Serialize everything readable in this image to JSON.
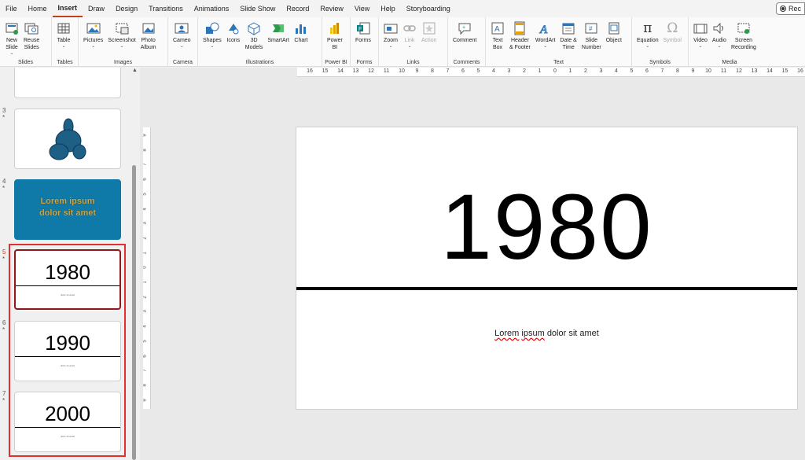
{
  "menu": {
    "tabs": [
      "File",
      "Home",
      "Insert",
      "Draw",
      "Design",
      "Transitions",
      "Animations",
      "Slide Show",
      "Record",
      "Review",
      "View",
      "Help",
      "Storyboarding"
    ],
    "active_tab": "Insert",
    "record_button": "Rec"
  },
  "ribbon": {
    "groups": {
      "slides": "Slides",
      "tables": "Tables",
      "images": "Images",
      "camera": "Camera",
      "illustrations": "Illustrations",
      "powerbi": "Power BI",
      "forms": "Forms",
      "links": "Links",
      "comments": "Comments",
      "text": "Text",
      "symbols": "Symbols",
      "media": "Media"
    },
    "buttons": {
      "new_slide": [
        "New",
        "Slide"
      ],
      "reuse_slides": [
        "Reuse",
        "Slides"
      ],
      "table": "Table",
      "pictures": "Pictures",
      "screenshot": "Screenshot",
      "photo_album": [
        "Photo",
        "Album"
      ],
      "cameo": "Cameo",
      "shapes": "Shapes",
      "icons": "Icons",
      "models_3d": [
        "3D",
        "Models"
      ],
      "smartart": "SmartArt",
      "chart": "Chart",
      "power_bi": [
        "Power",
        "BI"
      ],
      "forms": "Forms",
      "zoom": "Zoom",
      "link": "Link",
      "action": "Action",
      "comment": "Comment",
      "text_box": [
        "Text",
        "Box"
      ],
      "header_footer": [
        "Header",
        "& Footer"
      ],
      "wordart": "WordArt",
      "date_time": [
        "Date &",
        "Time"
      ],
      "slide_number": [
        "Slide",
        "Number"
      ],
      "object": "Object",
      "equation": "Equation",
      "symbol": "Symbol",
      "video": "Video",
      "audio": "Audio",
      "screen_recording": [
        "Screen",
        "Recording"
      ]
    }
  },
  "thumbnails": [
    {
      "number": "3",
      "star": "*",
      "kind": "shapes"
    },
    {
      "number": "4",
      "star": "*",
      "kind": "lorem",
      "text_line1": "Lorem ipsum",
      "text_line2": "dolor sit amet"
    },
    {
      "number": "5",
      "star": "*",
      "kind": "year",
      "year": "1980",
      "selected": true
    },
    {
      "number": "6",
      "star": "*",
      "kind": "year",
      "year": "1990"
    },
    {
      "number": "7",
      "star": "*",
      "kind": "year",
      "year": "2000"
    }
  ],
  "rulers": {
    "horizontal": [
      "16",
      "15",
      "14",
      "13",
      "12",
      "11",
      "10",
      "9",
      "8",
      "7",
      "6",
      "5",
      "4",
      "3",
      "2",
      "1",
      "0",
      "1",
      "2",
      "3",
      "4",
      "5",
      "6",
      "7",
      "8",
      "9",
      "10",
      "11",
      "12",
      "13",
      "14",
      "15",
      "16"
    ],
    "vertical": [
      "9",
      "8",
      "7",
      "6",
      "5",
      "4",
      "3",
      "2",
      "1",
      "0",
      "1",
      "2",
      "3",
      "4",
      "5",
      "6",
      "7",
      "8",
      "9"
    ]
  },
  "slide": {
    "title": "1980",
    "body_word1": "Lorem",
    "body_word2": "ipsum",
    "body_rest": "dolor sit amet"
  },
  "colors": {
    "accent": "#c43e1c",
    "selection_red": "#e03030",
    "thumb_blue": "#0f7aa8",
    "shape_blue": "#1e5f86"
  }
}
